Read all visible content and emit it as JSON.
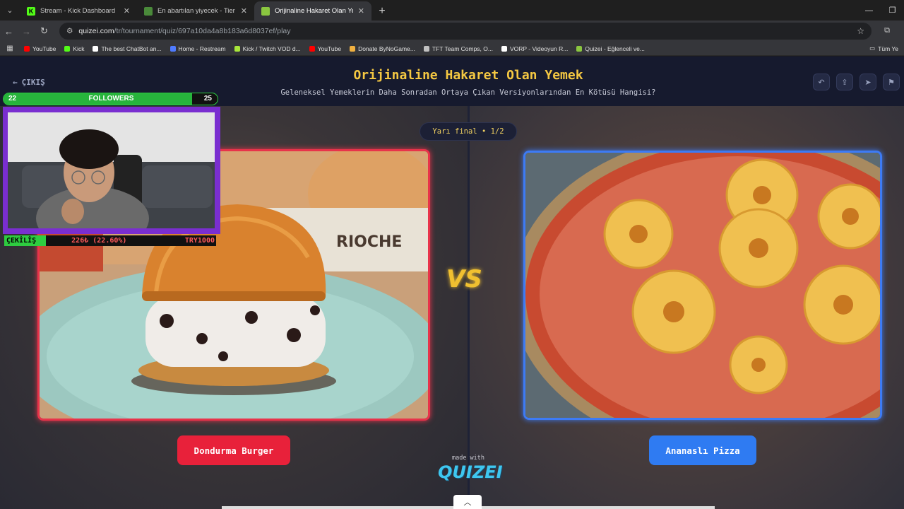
{
  "browser": {
    "tabs": [
      {
        "title": "Stream - Kick Dashboard",
        "favicon": "kick-icon",
        "active": false
      },
      {
        "title": "En abartılan yiyecek - Tier List |",
        "favicon": "tiermaker-icon",
        "active": false
      },
      {
        "title": "Orijinaline Hakaret Olan Yemek",
        "favicon": "quizei-icon",
        "active": true
      }
    ],
    "url_host": "quizei.com",
    "url_path": "/tr/tournament/quiz/697a10da4a8b183a6d8037ef/play",
    "bookmarks": [
      {
        "label": "YouTube",
        "icon": "youtube-icon",
        "color": "#ff0000"
      },
      {
        "label": "Kick",
        "icon": "kick-icon",
        "color": "#53fc18"
      },
      {
        "label": "The best ChatBot an...",
        "icon": "chatbot-icon",
        "color": "#ffffff"
      },
      {
        "label": "Home - Restream",
        "icon": "restream-icon",
        "color": "#4f7bff"
      },
      {
        "label": "Kick / Twitch VOD d...",
        "icon": "d-icon",
        "color": "#a8e63b"
      },
      {
        "label": "YouTube",
        "icon": "youtube-icon",
        "color": "#ff0000"
      },
      {
        "label": "Donate ByNoGame...",
        "icon": "bynogame-icon",
        "color": "#f0b040"
      },
      {
        "label": "TFT Team Comps, O...",
        "icon": "tft-icon",
        "color": "#c0c0c0"
      },
      {
        "label": "VORP - Videoyun R...",
        "icon": "vorp-icon",
        "color": "#ffffff"
      },
      {
        "label": "Quizei - Eğlenceli ve...",
        "icon": "quizei-icon",
        "color": "#8ac640"
      }
    ],
    "bookmarks_right": "Tüm Ye"
  },
  "page": {
    "exit_label": "ÇIKIŞ",
    "title": "Orijinaline Hakaret Olan Yemek",
    "subtitle": "Geleneksel Yemeklerin Daha Sonradan Ortaya Çıkan Versiyonlarından En Kötüsü Hangisi?",
    "round": "Yarı final • 1/2",
    "vs_label": "VS",
    "left_choice": "Dondurma Burger",
    "right_choice": "Ananaslı Pizza",
    "made_with": "made with",
    "brand": "QUIZEI",
    "header_icons": [
      "undo-icon",
      "share-icon",
      "send-icon",
      "flag-icon"
    ],
    "colors": {
      "title": "#f5c842",
      "left": "#e8213a",
      "right": "#2f7bf2"
    }
  },
  "overlay": {
    "followers_current": "22",
    "followers_label": "FOLLOWERS",
    "followers_goal": "25",
    "followers_progress": 0.88,
    "giveaway_label": "ÇEKİLİŞ",
    "giveaway_progress": "226₺ (22.60%)",
    "giveaway_goal": "TRY1000"
  }
}
